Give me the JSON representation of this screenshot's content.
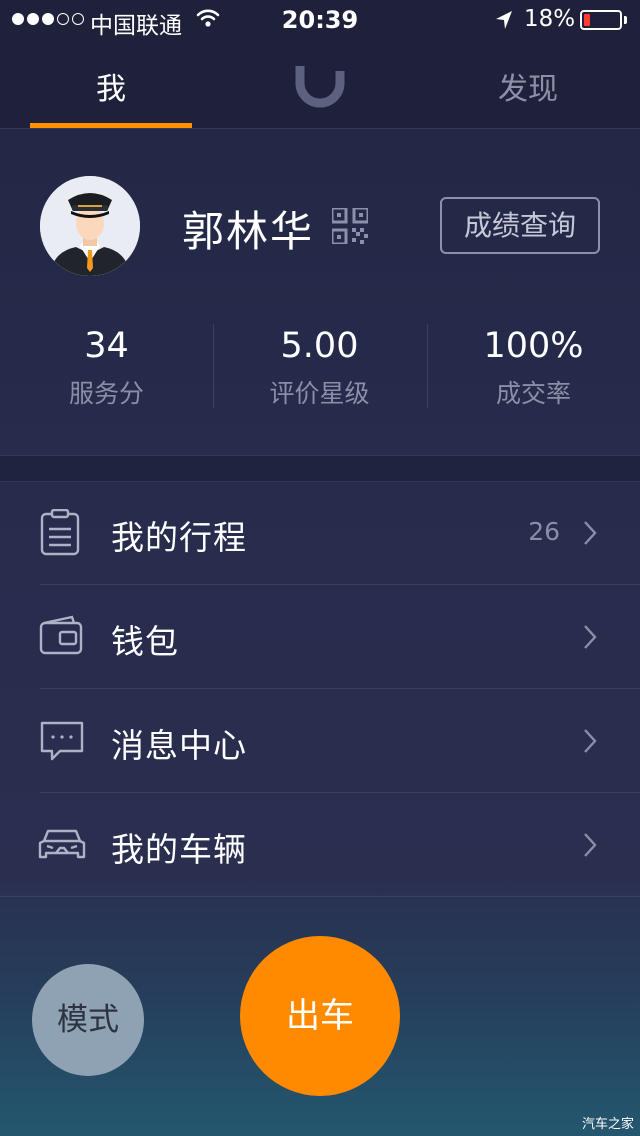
{
  "status_bar": {
    "carrier": "中国联通",
    "time": "20:39",
    "battery_percent": "18%",
    "battery_level": 0.18
  },
  "nav": {
    "tab_me": "我",
    "tab_discover": "发现",
    "logo_icon": "didi-logo-icon"
  },
  "profile": {
    "name": "郭林华",
    "query_button": "成绩查询"
  },
  "stats": [
    {
      "value": "34",
      "label": "服务分"
    },
    {
      "value": "5.00",
      "label": "评价星级"
    },
    {
      "value": "100%",
      "label": "成交率"
    }
  ],
  "menu": [
    {
      "label": "我的行程",
      "count": "26",
      "icon": "clipboard-icon"
    },
    {
      "label": "钱包",
      "count": "",
      "icon": "wallet-icon"
    },
    {
      "label": "消息中心",
      "count": "",
      "icon": "message-icon"
    },
    {
      "label": "我的车辆",
      "count": "",
      "icon": "car-icon"
    }
  ],
  "buttons": {
    "mode": "模式",
    "go": "出车"
  },
  "watermark": "汽车之家",
  "colors": {
    "accent": "#ff8a00",
    "background": "#272b4c",
    "battery_low": "#ff3b30"
  }
}
